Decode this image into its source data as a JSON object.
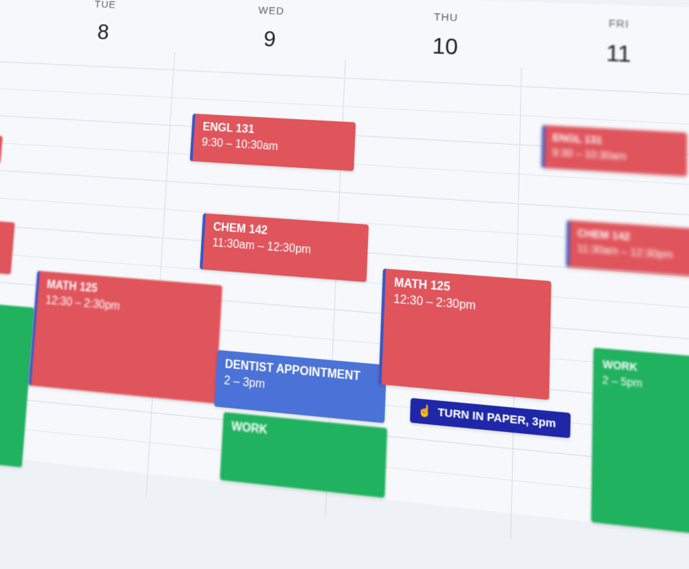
{
  "days": [
    {
      "dow": "TUE",
      "num": "8"
    },
    {
      "dow": "WED",
      "num": "9"
    },
    {
      "dow": "THU",
      "num": "10"
    },
    {
      "dow": "FRI",
      "num": "11"
    }
  ],
  "events": {
    "tue_math": {
      "title": "MATH 125",
      "time": "12:30 – 2:30pm"
    },
    "wed_engl": {
      "title": "ENGL 131",
      "time": "9:30 – 10:30am"
    },
    "wed_chem": {
      "title": "CHEM 142",
      "time": "11:30am – 12:30pm"
    },
    "wed_dentist": {
      "title": "DENTIST APPOINTMENT",
      "time": "2 – 3pm"
    },
    "wed_work": {
      "title": "WORK",
      "time": ""
    },
    "thu_math": {
      "title": "MATH 125",
      "time": "12:30 – 2:30pm"
    },
    "thu_task": {
      "title": "TURN IN PAPER, 3pm"
    },
    "fri_engl": {
      "title": "ENGL 131",
      "time": "9:30 – 10:30am"
    },
    "fri_chem": {
      "title": "CHEM 142",
      "time": "11:30am – 12:30pm"
    },
    "fri_work": {
      "title": "WORK",
      "time": "2 – 5pm"
    }
  },
  "colors": {
    "class_event": "#e0545c",
    "appointment": "#4b72d6",
    "work": "#20b25f",
    "task": "#1f27a8"
  }
}
